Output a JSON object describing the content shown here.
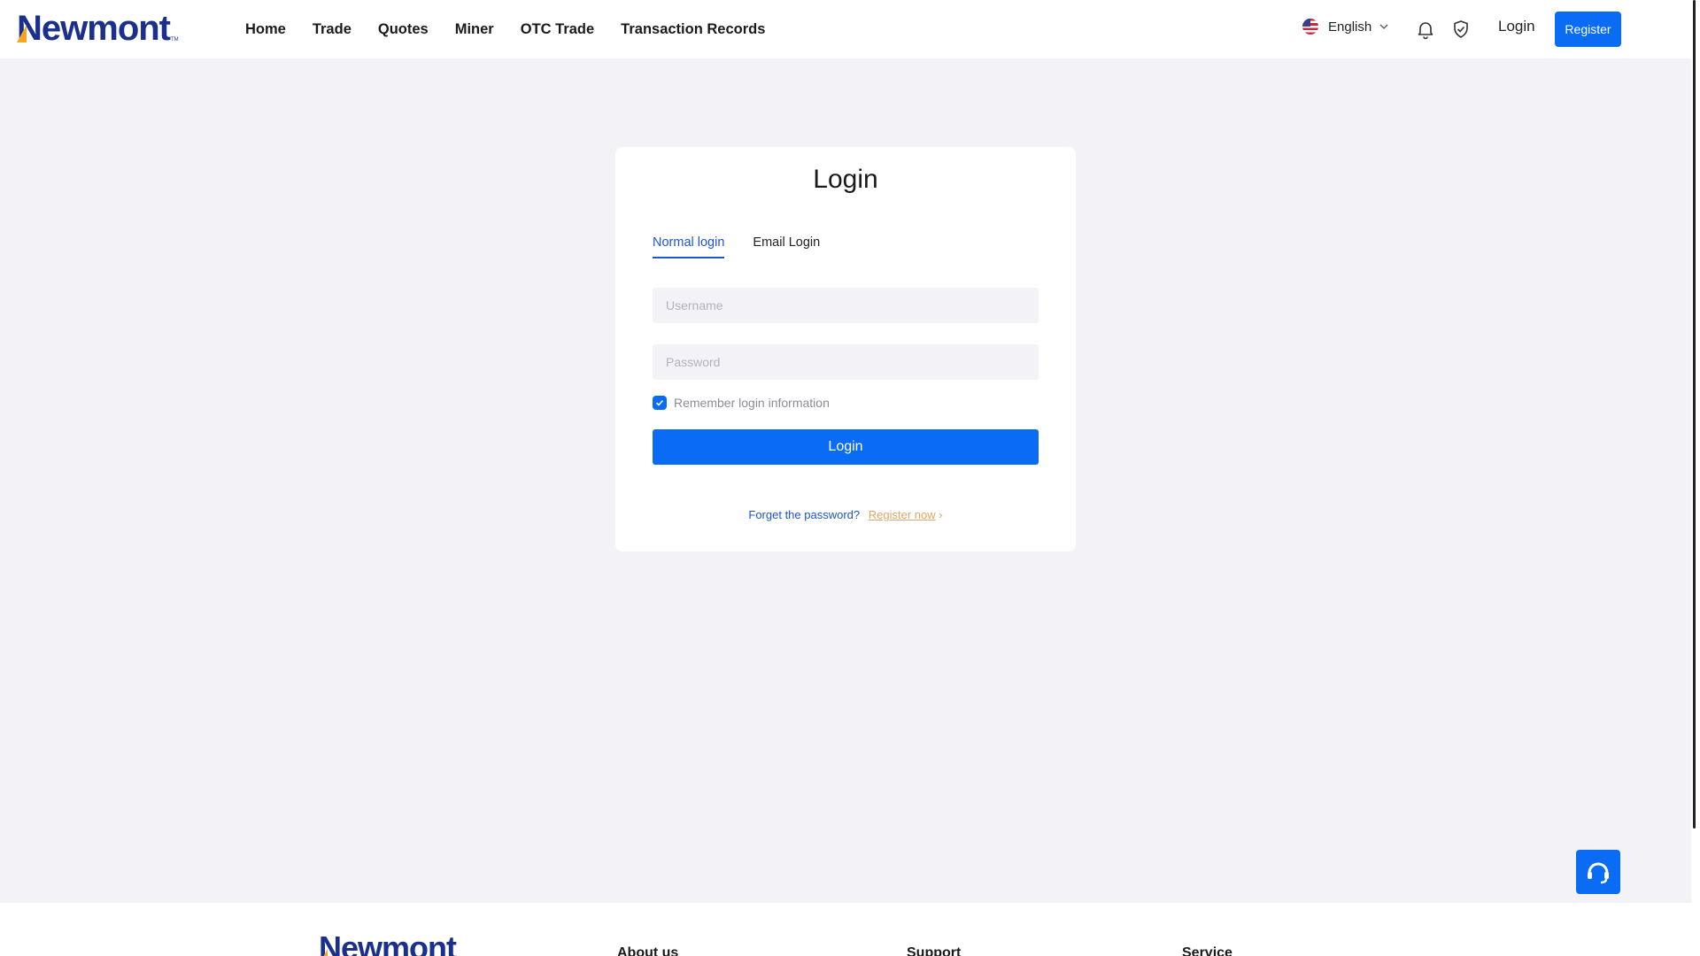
{
  "brand": {
    "name": "Newmont",
    "tm": "TM",
    "colors": {
      "navy": "#1b2f8c",
      "gold": "#f4a623",
      "accent": "#0a6cf5"
    }
  },
  "nav": {
    "items": [
      "Home",
      "Trade",
      "Quotes",
      "Miner",
      "OTC Trade",
      "Transaction Records"
    ]
  },
  "header": {
    "language": "English",
    "language_icon": "us-flag-icon",
    "login_label": "Login",
    "register_label": "Register"
  },
  "login": {
    "title": "Login",
    "tabs": [
      "Normal login",
      "Email Login"
    ],
    "active_tab": "Normal login",
    "username_placeholder": "Username",
    "password_placeholder": "Password",
    "remember_label": "Remember login information",
    "remember_checked": true,
    "submit_label": "Login",
    "forgot_label": "Forget the password?",
    "register_now_label": "Register now"
  },
  "footer": {
    "columns": [
      "About us",
      "Support",
      "Service"
    ]
  }
}
